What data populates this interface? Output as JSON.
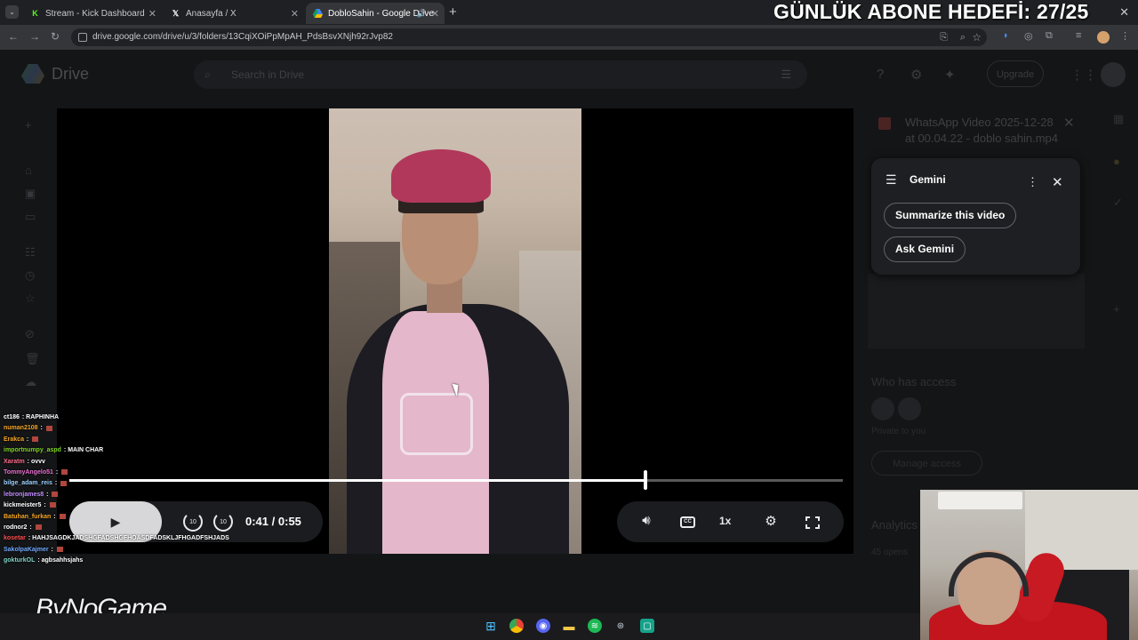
{
  "browser": {
    "tabs": [
      {
        "label": "Stream - Kick Dashboard",
        "favicon": "K",
        "color": "#53fc18"
      },
      {
        "label": "Anasayfa / X",
        "favicon": "X",
        "color": "#ffffff"
      },
      {
        "label": "DobloSahin - Google Drive",
        "favicon": "drive",
        "color": "#4285f4"
      }
    ],
    "url": "drive.google.com/drive/u/3/folders/13CqiXOiPpMpAH_PdsBsvXNjh92rJvp82"
  },
  "overlay": {
    "goal_text": "GÜNLÜK ABONE HEDEFİ: 27/25",
    "brand": "ByNoGame"
  },
  "drive": {
    "logo_text": "Drive",
    "search_placeholder": "Search in Drive",
    "upgrade_label": "Upgrade",
    "details": {
      "file_title": "WhatsApp Video 2025-12-28 at 00.04.22 - doblo sahin.mp4",
      "who_has_access": "Who has access",
      "private_label": "Private to you",
      "manage_access": "Manage access",
      "analytics": "Analytics",
      "opens": "45 opens"
    }
  },
  "player": {
    "current_time": "0:41",
    "duration": "/ 0:55",
    "progress_fraction": 0.745,
    "buffered_fraction": 0.2,
    "speed_label": "1x",
    "cc_label": "CC",
    "rewind_label": "10",
    "forward_label": "10"
  },
  "gemini": {
    "title": "Gemini",
    "chips": [
      "Summarize this video",
      "Ask Gemini"
    ]
  },
  "chat": [
    {
      "user": "ct186",
      "msg": "RAPHINHA",
      "color": "#ffffff"
    },
    {
      "user": "numan2108",
      "msg": "",
      "color": "#f5a623"
    },
    {
      "user": "Erakca",
      "msg": "",
      "color": "#f5a623"
    },
    {
      "user": "importnumpy_aspd",
      "msg": "MAIN CHAR",
      "color": "#7ed321"
    },
    {
      "user": "Xaratm",
      "msg": "ovvv",
      "color": "#ff6b8a"
    },
    {
      "user": "TommyAngelo51",
      "msg": "",
      "color": "#e86fd0"
    },
    {
      "user": "bilge_adam_reis",
      "msg": "",
      "color": "#9ad0ff"
    },
    {
      "user": "lebronjames8",
      "msg": "",
      "color": "#c08cff"
    },
    {
      "user": "kickmeister5",
      "msg": "",
      "color": "#ffffff"
    },
    {
      "user": "Batuhan_furkan",
      "msg": "",
      "color": "#f5a623"
    },
    {
      "user": "rodnor2",
      "msg": "",
      "color": "#ffffff"
    },
    {
      "user": "kosetar",
      "msg": "HAHJSAGDKJADSHGFADSHGFHOASDFADSKLJFHGADFSHJADS",
      "color": "#ff4d4d"
    },
    {
      "user": "SakolpaKajmer",
      "msg": "",
      "color": "#6fa8ff"
    },
    {
      "user": "gokturkOL",
      "msg": "agbsahhsjahs",
      "color": "#7ed3c7"
    }
  ]
}
